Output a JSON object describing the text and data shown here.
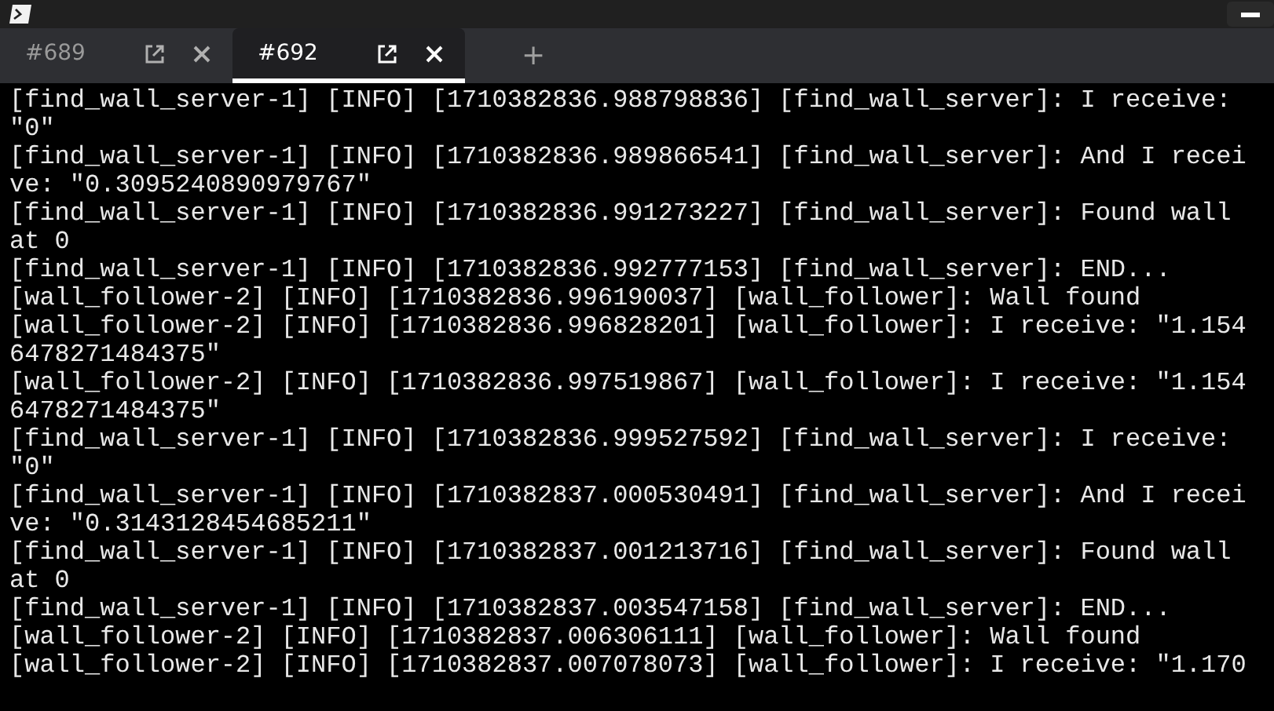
{
  "tabs": [
    {
      "label": "#689",
      "selected": false
    },
    {
      "label": "#692",
      "selected": true
    }
  ],
  "new_tab": "+",
  "terminal_lines": [
    "[find_wall_server-1] [INFO] [1710382836.988798836] [find_wall_server]: I receive:",
    "\"0\"",
    "[find_wall_server-1] [INFO] [1710382836.989866541] [find_wall_server]: And I recei",
    "ve: \"0.3095240890979767\"",
    "[find_wall_server-1] [INFO] [1710382836.991273227] [find_wall_server]: Found wall",
    "at 0",
    "[find_wall_server-1] [INFO] [1710382836.992777153] [find_wall_server]: END...",
    "[wall_follower-2] [INFO] [1710382836.996190037] [wall_follower]: Wall found",
    "[wall_follower-2] [INFO] [1710382836.996828201] [wall_follower]: I receive: \"1.154",
    "6478271484375\"",
    "[wall_follower-2] [INFO] [1710382836.997519867] [wall_follower]: I receive: \"1.154",
    "6478271484375\"",
    "[find_wall_server-1] [INFO] [1710382836.999527592] [find_wall_server]: I receive:",
    "\"0\"",
    "[find_wall_server-1] [INFO] [1710382837.000530491] [find_wall_server]: And I recei",
    "ve: \"0.3143128454685211\"",
    "[find_wall_server-1] [INFO] [1710382837.001213716] [find_wall_server]: Found wall",
    "at 0",
    "[find_wall_server-1] [INFO] [1710382837.003547158] [find_wall_server]: END...",
    "[wall_follower-2] [INFO] [1710382837.006306111] [wall_follower]: Wall found",
    "[wall_follower-2] [INFO] [1710382837.007078073] [wall_follower]: I receive: \"1.170"
  ]
}
